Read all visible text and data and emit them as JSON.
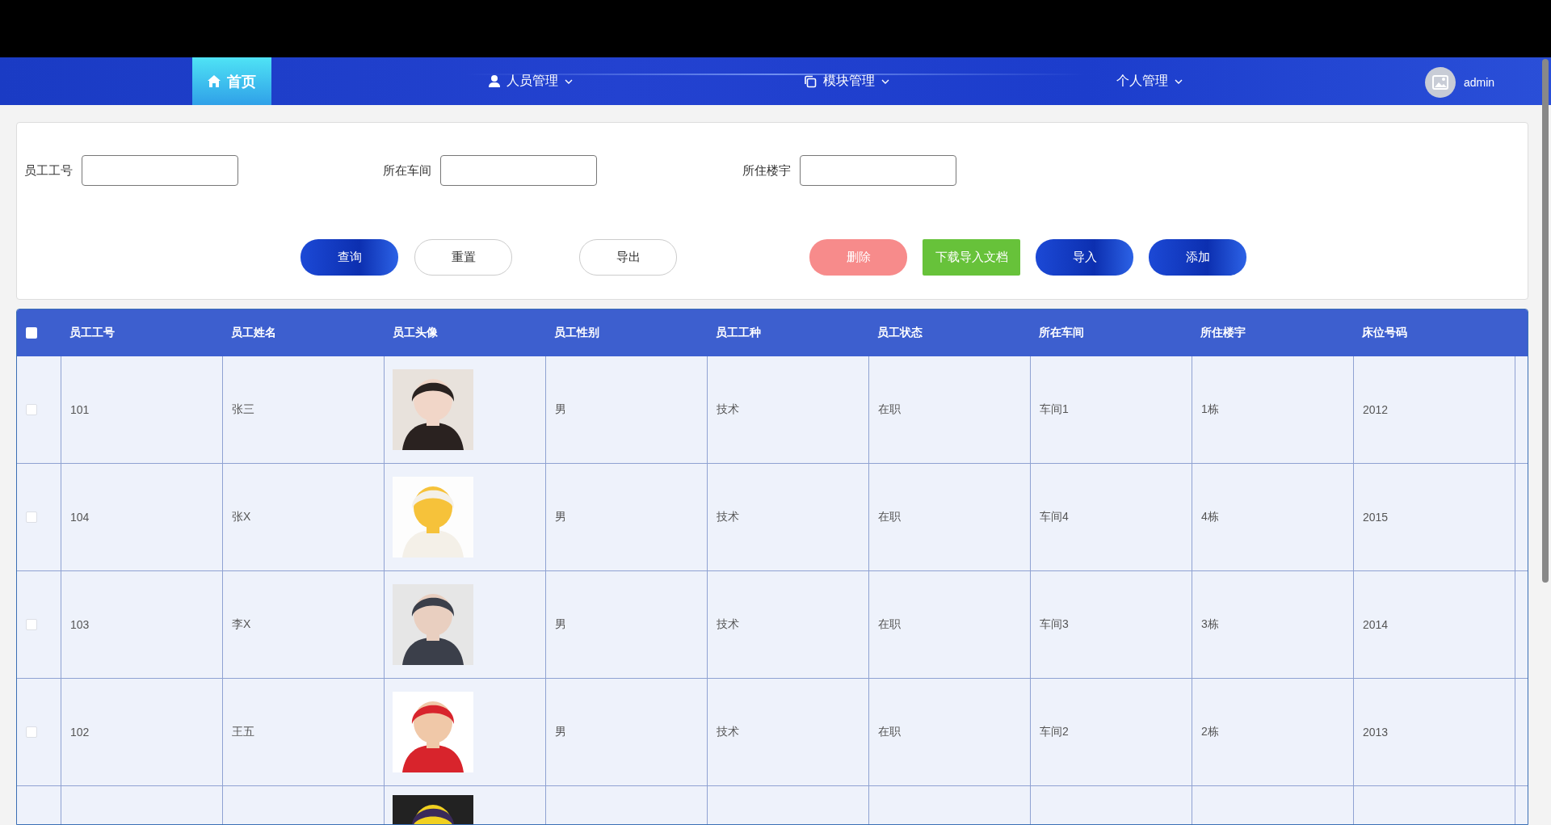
{
  "top_nav": {
    "items": [
      {
        "label": "首页",
        "dropdown": false,
        "selected": true
      },
      {
        "label": "人员管理",
        "dropdown": true,
        "selected": false
      },
      {
        "label": "模块管理",
        "dropdown": true,
        "selected": false
      },
      {
        "label": "个人管理",
        "dropdown": true,
        "selected": false
      }
    ],
    "user": {
      "name": "admin"
    }
  },
  "search": {
    "fields": [
      {
        "label": "员工工号"
      },
      {
        "label": "所在车间"
      },
      {
        "label": "所住楼宇"
      }
    ],
    "buttons": [
      {
        "label": "查询",
        "kind": "primary"
      },
      {
        "label": "重置",
        "kind": "plain"
      },
      {
        "label": "导出",
        "kind": "plain"
      },
      {
        "label": "删除",
        "kind": "danger"
      },
      {
        "label": "下载导入文档",
        "kind": "success"
      },
      {
        "label": "导入",
        "kind": "primary"
      },
      {
        "label": "添加",
        "kind": "primary"
      }
    ]
  },
  "table": {
    "select_all": false,
    "columns": [
      "员工工号",
      "员工姓名",
      "员工头像",
      "员工性别",
      "员工工种",
      "员工状态",
      "所在车间",
      "所住楼宇",
      "床位号码"
    ],
    "rows": [
      {
        "checked": false,
        "cells": [
          "101",
          "张三",
          {
            "kind": "picture"
          },
          "男",
          "技术",
          "在职",
          "车间1",
          "1栋",
          "2012"
        ]
      },
      {
        "checked": false,
        "cells": [
          "104",
          "张X",
          {
            "kind": "picture"
          },
          "男",
          "技术",
          "在职",
          "车间4",
          "4栋",
          "2015"
        ]
      },
      {
        "checked": false,
        "cells": [
          "103",
          "李X",
          {
            "kind": "picture"
          },
          "男",
          "技术",
          "在职",
          "车间3",
          "3栋",
          "2014"
        ]
      },
      {
        "checked": false,
        "cells": [
          "102",
          "王五",
          {
            "kind": "picture"
          },
          "男",
          "技术",
          "在职",
          "车间2",
          "2栋",
          "2013"
        ]
      },
      {
        "cells": [
          "",
          "",
          {
            "kind": "picture"
          },
          "",
          "",
          "",
          "",
          "",
          ""
        ]
      }
    ]
  }
}
